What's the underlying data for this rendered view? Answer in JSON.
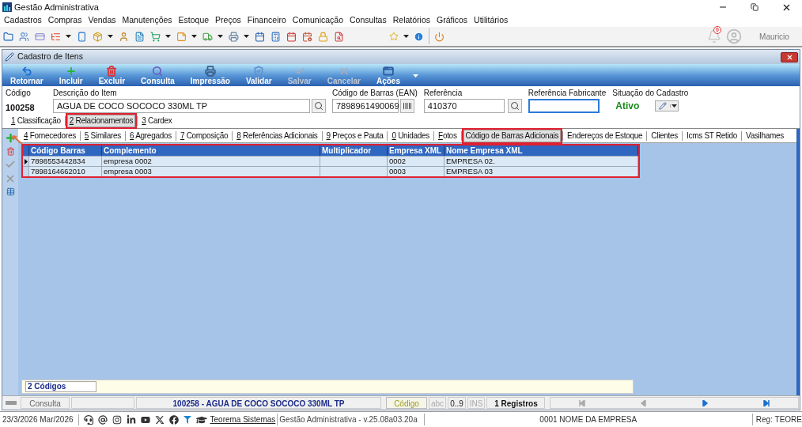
{
  "app": {
    "title": "Gestão Administrativa"
  },
  "menu": [
    "Cadastros",
    "Compras",
    "Vendas",
    "Manutenções",
    "Estoque",
    "Preços",
    "Financeiro",
    "Comunicação",
    "Consultas",
    "Relatórios",
    "Gráficos",
    "Utilitários"
  ],
  "user": {
    "notifications": "0",
    "name": "Mauricio"
  },
  "window": {
    "title": "Cadastro de Itens"
  },
  "actions": [
    {
      "kind": "undo",
      "label": "Retornar",
      "disabled": false
    },
    {
      "kind": "plus",
      "label": "Incluir",
      "disabled": false
    },
    {
      "kind": "trash",
      "label": "Excluir",
      "disabled": false
    },
    {
      "kind": "search",
      "label": "Consulta",
      "disabled": false
    },
    {
      "kind": "print",
      "label": "Impressão",
      "disabled": false
    },
    {
      "kind": "validate",
      "label": "Validar",
      "disabled": false
    },
    {
      "kind": "check",
      "label": "Salvar",
      "disabled": true
    },
    {
      "kind": "cancel",
      "label": "Cancelar",
      "disabled": true
    },
    {
      "kind": "actions",
      "label": "Ações",
      "disabled": false
    }
  ],
  "form": {
    "codigo": {
      "label": "Código",
      "value": "100258"
    },
    "descricao": {
      "label": "Descrição do Item",
      "value": "AGUA DE COCO SOCOCO 330ML TP"
    },
    "ean": {
      "label": "Código de Barras (EAN)",
      "value": "7898961490069"
    },
    "referencia": {
      "label": "Referência",
      "value": "410370"
    },
    "ref_fabricante": {
      "label": "Referência Fabricante",
      "focused": true
    },
    "situacao": {
      "label": "Situação do Cadastro",
      "value": "Ativo"
    }
  },
  "tabs": [
    {
      "label": "1 Classificação",
      "underline_first": true,
      "selected": false,
      "highlighted": false
    },
    {
      "label": "2 Relacionamentos",
      "underline_first": true,
      "selected": true,
      "highlighted": true
    },
    {
      "label": "3 Cardex",
      "underline_first": true,
      "selected": false,
      "highlighted": false
    }
  ],
  "subtabs": [
    {
      "label": "4 Fornecedores",
      "underline_first": true,
      "selected": false,
      "highlighted": false
    },
    {
      "label": "5 Similares",
      "underline_first": true,
      "selected": false,
      "highlighted": false
    },
    {
      "label": "6 Agregados",
      "underline_first": true,
      "selected": false,
      "highlighted": false
    },
    {
      "label": "7 Composição",
      "underline_first": true,
      "selected": false,
      "highlighted": false
    },
    {
      "label": "8 Referências Adicionais",
      "underline_first": true,
      "selected": false,
      "highlighted": false
    },
    {
      "label": "9 Preços e Pauta",
      "underline_first": true,
      "selected": false,
      "highlighted": false
    },
    {
      "label": "0 Unidades",
      "underline_first": true,
      "selected": false,
      "highlighted": false
    },
    {
      "label": "Fotos",
      "underline_first": true,
      "selected": false,
      "highlighted": false
    },
    {
      "label": "Código de Barras Adicionais",
      "underline_first": false,
      "selected": true,
      "highlighted": true
    },
    {
      "label": "Endereços de Estoque",
      "underline_first": false,
      "selected": false,
      "highlighted": false
    },
    {
      "label": "Clientes",
      "underline_first": false,
      "selected": false,
      "highlighted": false
    },
    {
      "label": "Icms ST Retido",
      "underline_first": false,
      "selected": false,
      "highlighted": false
    },
    {
      "label": "Vasilhames",
      "underline_first": false,
      "selected": false,
      "highlighted": false
    }
  ],
  "grid": {
    "highlighted": true,
    "columns": [
      "Código Barras",
      "Complemento",
      "Multiplicador",
      "Empresa XML",
      "Nome Empresa XML"
    ],
    "rows": [
      {
        "current": true,
        "cells": [
          "7898553442834",
          "empresa 0002",
          "",
          "0002",
          "EMPRESA 02."
        ]
      },
      {
        "current": false,
        "cells": [
          "7898164662010",
          "empresa 0003",
          "",
          "0003",
          "EMPRESA 03"
        ]
      }
    ]
  },
  "footer_count": "2 Códigos",
  "status_bar": {
    "mode": "Consulta",
    "item": "100258 - AGUA DE COCO SOCOCO 330ML TP",
    "search_button": "Código",
    "flags": [
      {
        "label": "abc",
        "disabled": true
      },
      {
        "label": "0..9",
        "disabled": false
      },
      {
        "label": "INS",
        "disabled": true
      }
    ],
    "records": "1 Registros",
    "nav": [
      {
        "kind": "first",
        "disabled": true
      },
      {
        "kind": "prev",
        "disabled": true
      },
      {
        "kind": "next",
        "disabled": false
      },
      {
        "kind": "last",
        "disabled": false
      }
    ]
  },
  "bottom_bar": {
    "date": "23/3/2026 Mar/2026",
    "link": "Teorema Sistemas",
    "version": "Gestão Administrativa - v.25.08a03.20a",
    "company": "0001 NOME DA EMPRESA",
    "reg": "Reg: TEORE"
  }
}
